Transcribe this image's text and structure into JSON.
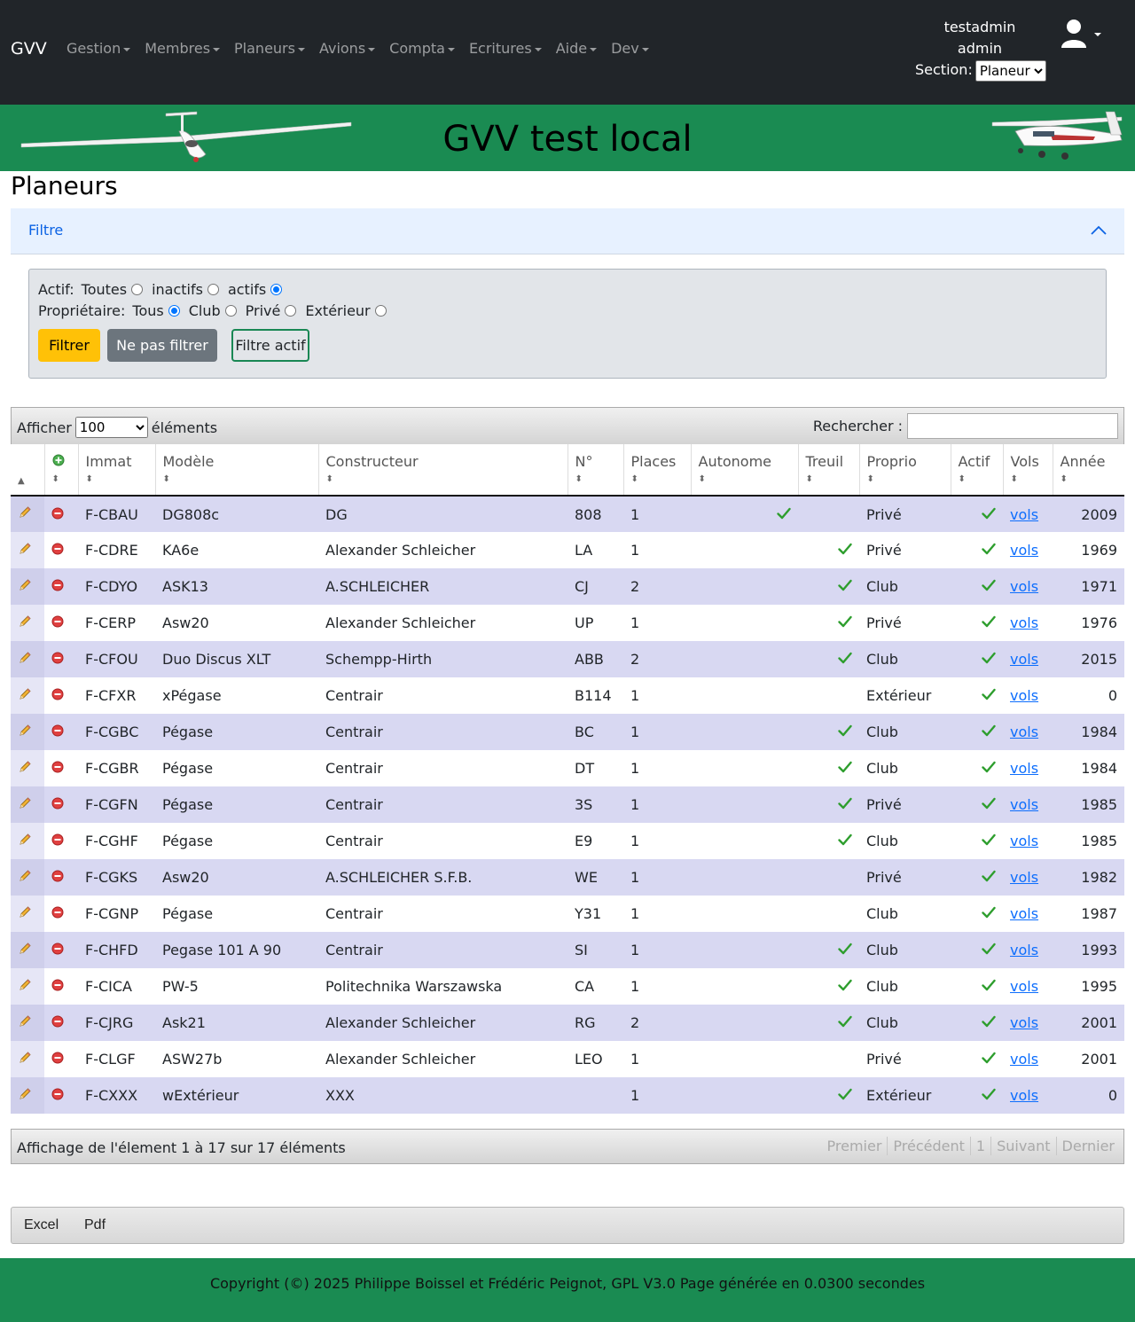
{
  "nav": {
    "brand": "GVV",
    "menu": [
      "Gestion",
      "Membres",
      "Planeurs",
      "Avions",
      "Compta",
      "Ecritures",
      "Aide",
      "Dev"
    ],
    "username": "testadmin",
    "role": "admin",
    "section_label": "Section:",
    "section_value": "Planeur"
  },
  "banner": {
    "title": "GVV test local"
  },
  "page": {
    "title": "Planeurs"
  },
  "filter": {
    "header": "Filtre",
    "actif_label": "Actif:",
    "actif_options": [
      {
        "label": "Toutes",
        "checked": false
      },
      {
        "label": "inactifs",
        "checked": false
      },
      {
        "label": "actifs",
        "checked": true
      }
    ],
    "proprio_label": "Propriétaire:",
    "proprio_options": [
      {
        "label": "Tous",
        "checked": true
      },
      {
        "label": "Club",
        "checked": false
      },
      {
        "label": "Privé",
        "checked": false
      },
      {
        "label": "Extérieur",
        "checked": false
      }
    ],
    "btn_filter": "Filtrer",
    "btn_nofilter": "Ne pas filtrer",
    "btn_active": "Filtre actif"
  },
  "table": {
    "show_prefix": "Afficher",
    "show_value": "100",
    "show_suffix": "éléments",
    "search_label": "Rechercher :",
    "headers": [
      "Immat",
      "Modèle",
      "Constructeur",
      "N°",
      "Places",
      "Autonome",
      "Treuil",
      "Proprio",
      "Actif",
      "Vols",
      "Année"
    ],
    "rows": [
      {
        "immat": "F-CBAU",
        "modele": "DG808c",
        "constructeur": "DG",
        "num": "808",
        "places": "1",
        "autonome": true,
        "treuil": false,
        "proprio": "Privé",
        "actif": true,
        "vols": "vols",
        "annee": "2009"
      },
      {
        "immat": "F-CDRE",
        "modele": "KA6e",
        "constructeur": "Alexander Schleicher",
        "num": "LA",
        "places": "1",
        "autonome": false,
        "treuil": true,
        "proprio": "Privé",
        "actif": true,
        "vols": "vols",
        "annee": "1969"
      },
      {
        "immat": "F-CDYO",
        "modele": "ASK13",
        "constructeur": "A.SCHLEICHER",
        "num": "CJ",
        "places": "2",
        "autonome": false,
        "treuil": true,
        "proprio": "Club",
        "actif": true,
        "vols": "vols",
        "annee": "1971"
      },
      {
        "immat": "F-CERP",
        "modele": "Asw20",
        "constructeur": "Alexander Schleicher",
        "num": "UP",
        "places": "1",
        "autonome": false,
        "treuil": true,
        "proprio": "Privé",
        "actif": true,
        "vols": "vols",
        "annee": "1976"
      },
      {
        "immat": "F-CFOU",
        "modele": "Duo Discus XLT",
        "constructeur": "Schempp-Hirth",
        "num": "ABB",
        "places": "2",
        "autonome": false,
        "treuil": true,
        "proprio": "Club",
        "actif": true,
        "vols": "vols",
        "annee": "2015"
      },
      {
        "immat": "F-CFXR",
        "modele": "xPégase",
        "constructeur": "Centrair",
        "num": "B114",
        "places": "1",
        "autonome": false,
        "treuil": false,
        "proprio": "Extérieur",
        "actif": true,
        "vols": "vols",
        "annee": "0"
      },
      {
        "immat": "F-CGBC",
        "modele": "Pégase",
        "constructeur": "Centrair",
        "num": "BC",
        "places": "1",
        "autonome": false,
        "treuil": true,
        "proprio": "Club",
        "actif": true,
        "vols": "vols",
        "annee": "1984"
      },
      {
        "immat": "F-CGBR",
        "modele": "Pégase",
        "constructeur": "Centrair",
        "num": "DT",
        "places": "1",
        "autonome": false,
        "treuil": true,
        "proprio": "Club",
        "actif": true,
        "vols": "vols",
        "annee": "1984"
      },
      {
        "immat": "F-CGFN",
        "modele": "Pégase",
        "constructeur": "Centrair",
        "num": "3S",
        "places": "1",
        "autonome": false,
        "treuil": true,
        "proprio": "Privé",
        "actif": true,
        "vols": "vols",
        "annee": "1985"
      },
      {
        "immat": "F-CGHF",
        "modele": "Pégase",
        "constructeur": "Centrair",
        "num": "E9",
        "places": "1",
        "autonome": false,
        "treuil": true,
        "proprio": "Club",
        "actif": true,
        "vols": "vols",
        "annee": "1985"
      },
      {
        "immat": "F-CGKS",
        "modele": "Asw20",
        "constructeur": "A.SCHLEICHER S.F.B.",
        "num": "WE",
        "places": "1",
        "autonome": false,
        "treuil": false,
        "proprio": "Privé",
        "actif": true,
        "vols": "vols",
        "annee": "1982"
      },
      {
        "immat": "F-CGNP",
        "modele": "Pégase",
        "constructeur": "Centrair",
        "num": "Y31",
        "places": "1",
        "autonome": false,
        "treuil": false,
        "proprio": "Club",
        "actif": true,
        "vols": "vols",
        "annee": "1987"
      },
      {
        "immat": "F-CHFD",
        "modele": "Pegase 101 A 90",
        "constructeur": "Centrair",
        "num": "SI",
        "places": "1",
        "autonome": false,
        "treuil": true,
        "proprio": "Club",
        "actif": true,
        "vols": "vols",
        "annee": "1993"
      },
      {
        "immat": "F-CICA",
        "modele": "PW-5",
        "constructeur": "Politechnika Warszawska",
        "num": "CA",
        "places": "1",
        "autonome": false,
        "treuil": true,
        "proprio": "Club",
        "actif": true,
        "vols": "vols",
        "annee": "1995"
      },
      {
        "immat": "F-CJRG",
        "modele": "Ask21",
        "constructeur": "Alexander Schleicher",
        "num": "RG",
        "places": "2",
        "autonome": false,
        "treuil": true,
        "proprio": "Club",
        "actif": true,
        "vols": "vols",
        "annee": "2001"
      },
      {
        "immat": "F-CLGF",
        "modele": "ASW27b",
        "constructeur": "Alexander Schleicher",
        "num": "LEO",
        "places": "1",
        "autonome": false,
        "treuil": false,
        "proprio": "Privé",
        "actif": true,
        "vols": "vols",
        "annee": "2001"
      },
      {
        "immat": "F-CXXX",
        "modele": "wExtérieur",
        "constructeur": "XXX",
        "num": "",
        "places": "1",
        "autonome": false,
        "treuil": true,
        "proprio": "Extérieur",
        "actif": true,
        "vols": "vols",
        "annee": "0"
      }
    ],
    "info": "Affichage de l'élement 1 à 17 sur 17 éléments",
    "pager": [
      "Premier",
      "Précédent",
      "1",
      "Suivant",
      "Dernier"
    ]
  },
  "export": {
    "excel": "Excel",
    "pdf": "Pdf"
  },
  "footer": {
    "text": "Copyright (©) 2025 Philippe Boissel et Frédéric Peignot, GPL V3.0 Page générée en 0.0300 secondes"
  },
  "colors": {
    "navbar": "#212529",
    "banner": "#1a8b52",
    "accent": "#0d6efd",
    "check": "#2e9e2e",
    "delete": "#e04040"
  }
}
